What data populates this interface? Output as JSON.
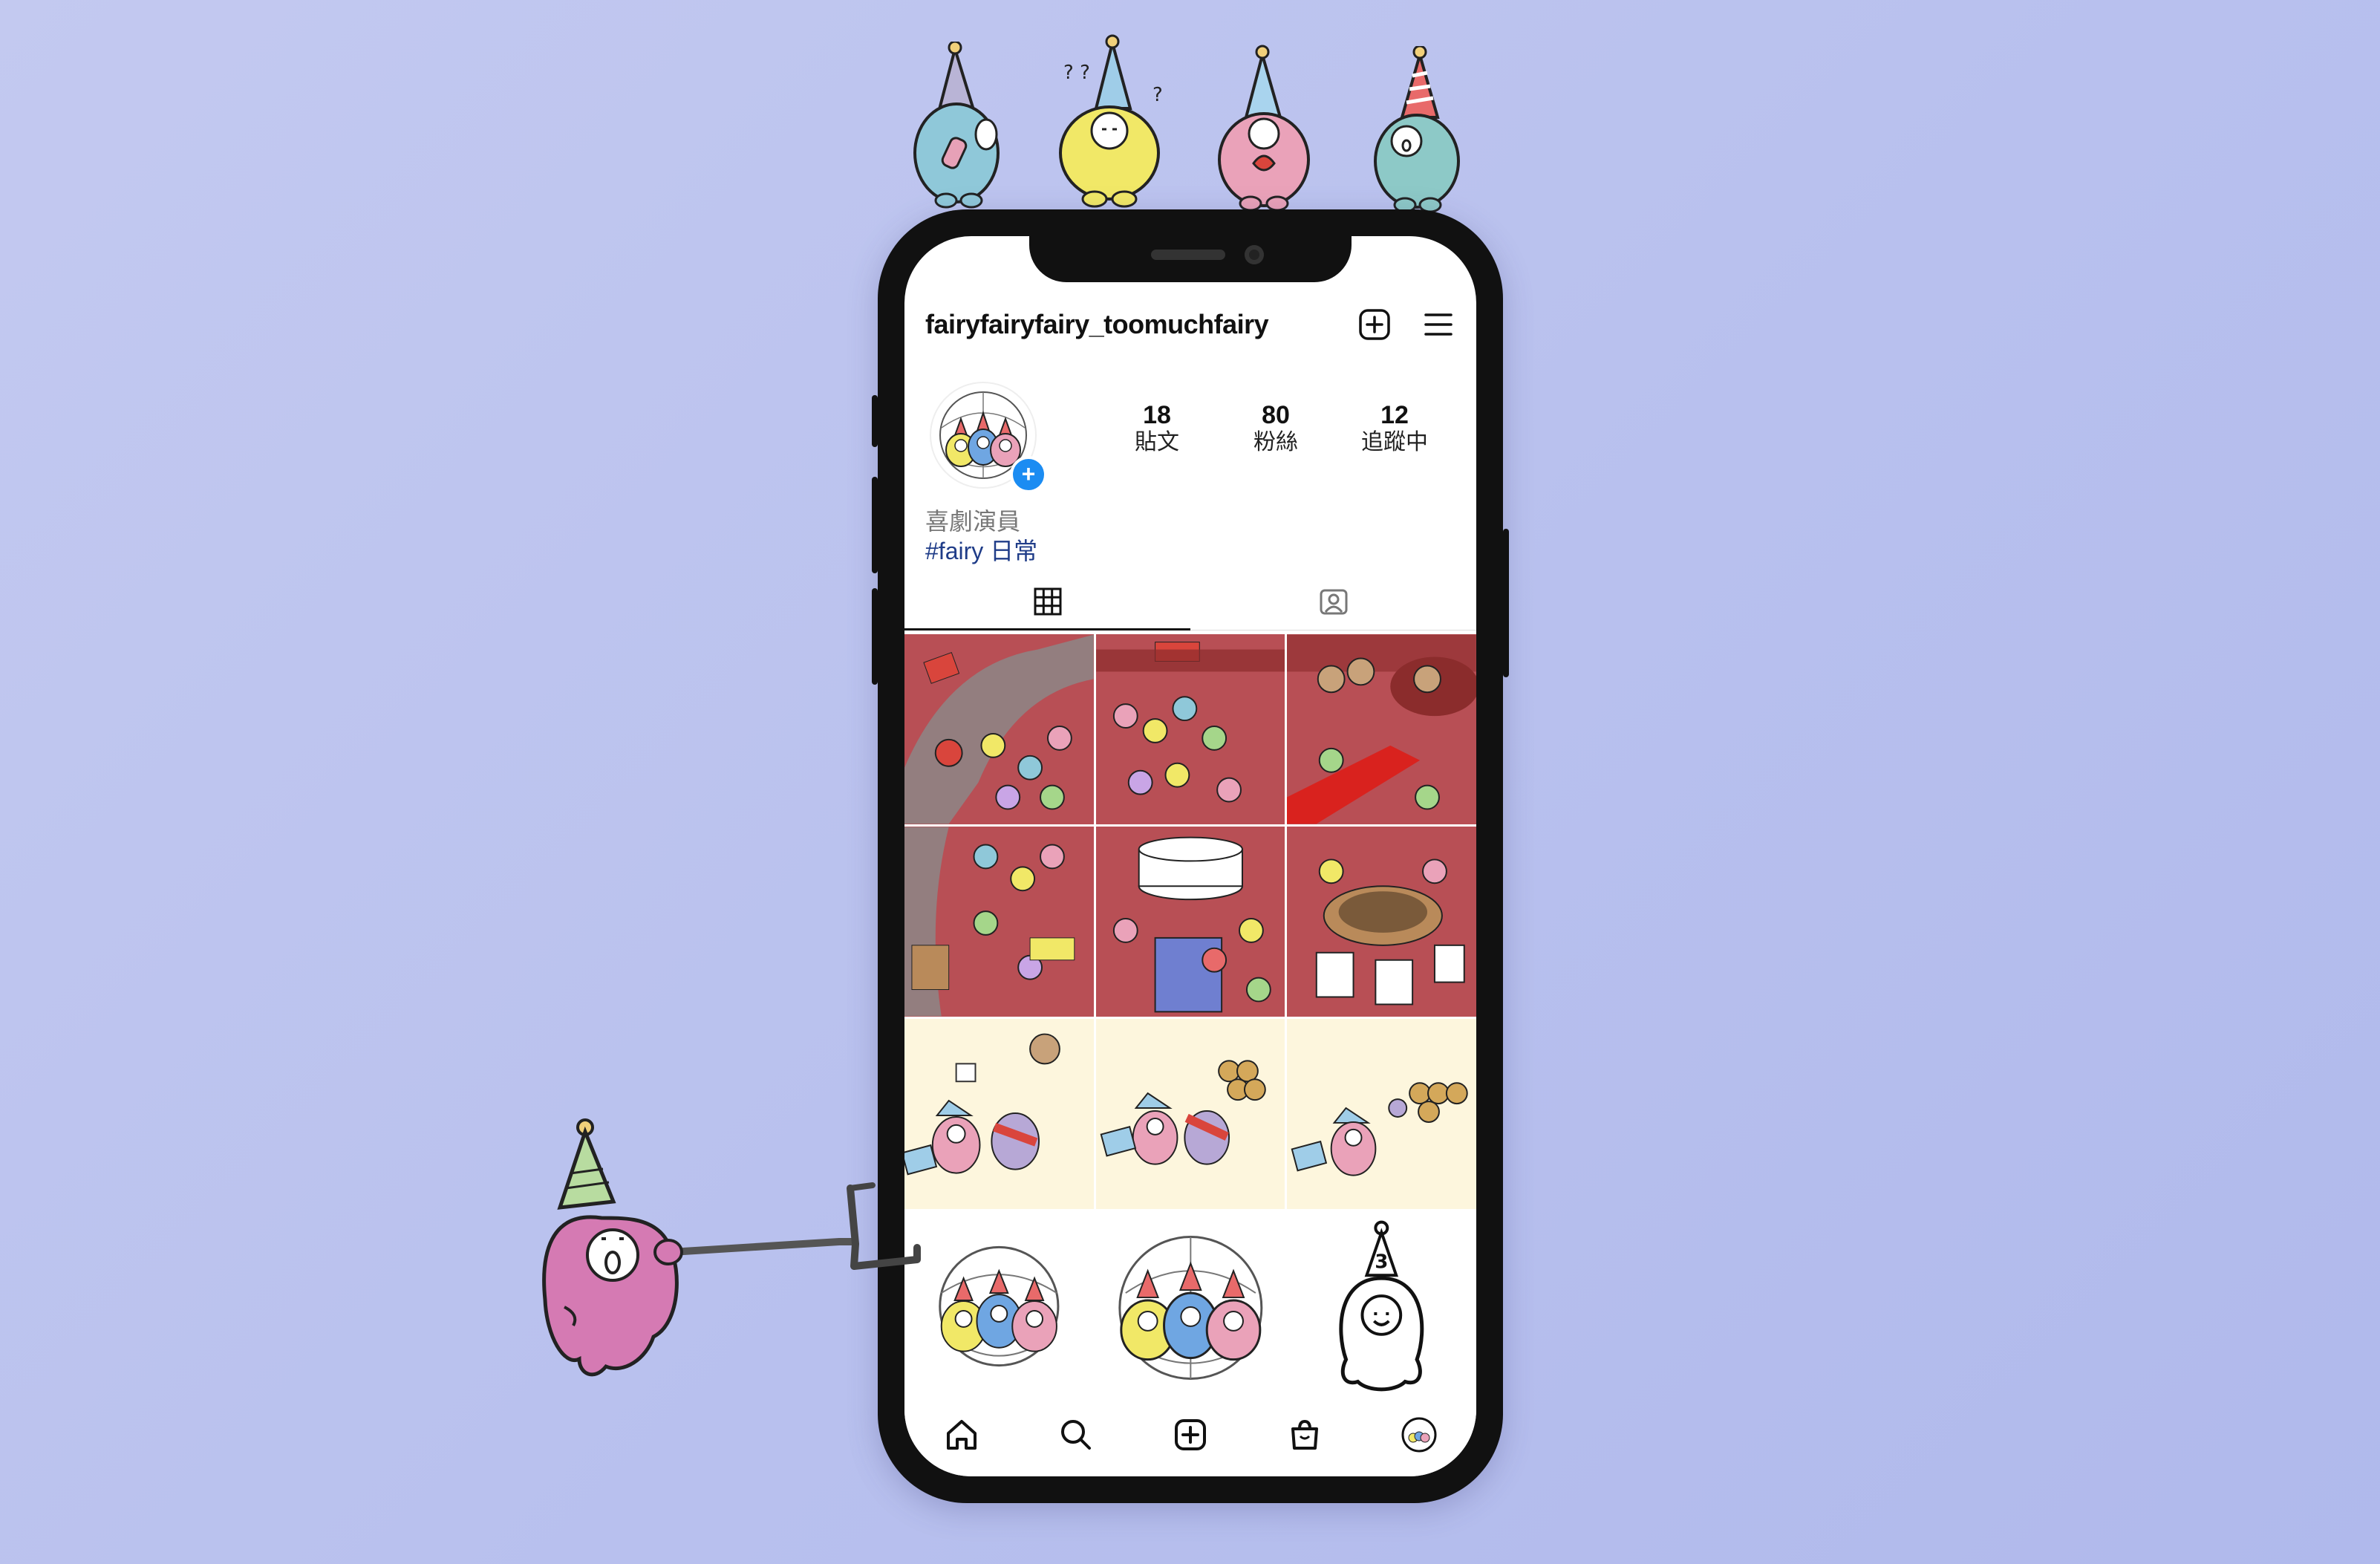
{
  "profile": {
    "username": "fairyfairyfairy_toomuchfairy",
    "stats": [
      {
        "value": "18",
        "label": "貼文"
      },
      {
        "value": "80",
        "label": "粉絲"
      },
      {
        "value": "12",
        "label": "追蹤中"
      }
    ],
    "bio_category": "喜劇演員",
    "bio_hashtag": "#fairy 日常"
  },
  "header_icons": [
    "new-post-icon",
    "menu-icon"
  ],
  "tabs": [
    "grid-tab-icon",
    "tagged-tab-icon"
  ],
  "bottom_nav": [
    "home-icon",
    "search-icon",
    "create-icon",
    "shop-icon",
    "profile-avatar-icon"
  ],
  "grid_posts": [
    {
      "type": "party-scene"
    },
    {
      "type": "party-scene"
    },
    {
      "type": "party-scene"
    },
    {
      "type": "party-scene"
    },
    {
      "type": "party-scene"
    },
    {
      "type": "party-scene"
    },
    {
      "type": "comic-panel"
    },
    {
      "type": "comic-panel"
    },
    {
      "type": "comic-panel"
    },
    {
      "type": "fairy-group-circle"
    },
    {
      "type": "fairy-group-circle"
    },
    {
      "type": "single-fairy-outline"
    }
  ],
  "decor": {
    "single_fairy_number": "3"
  },
  "colors": {
    "background": "#b9c1ee",
    "link": "#1f3c88",
    "badge": "#1b8cf2",
    "party_red": "#b84f55",
    "cream": "#fdf6dd"
  }
}
